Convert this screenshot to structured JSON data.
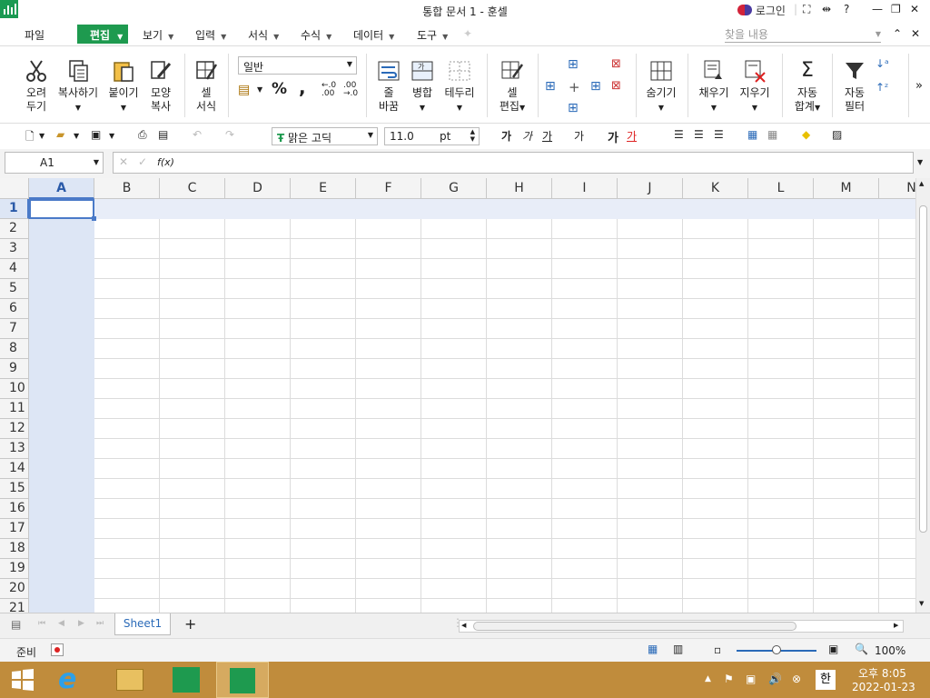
{
  "window": {
    "title": "통합 문서 1 - 훈셀",
    "login": "로그인",
    "help": "?"
  },
  "menu": {
    "items": [
      "파일",
      "편집",
      "보기",
      "입력",
      "서식",
      "수식",
      "데이터",
      "도구"
    ],
    "search_placeholder": "찾을 내용"
  },
  "ribbon": {
    "cut": [
      "오려",
      "두기"
    ],
    "copy": "복사하기",
    "paste": "붙이기",
    "format_painter": [
      "모양",
      "복사"
    ],
    "cell_format": [
      "셀",
      "서식"
    ],
    "number_format": "일반",
    "percent": "%",
    "comma": ",",
    "wrap": [
      "줄",
      "바꿈"
    ],
    "merge": "병합",
    "border": "테두리",
    "cell_edit": [
      "셀",
      "편집"
    ],
    "hide": "숨기기",
    "fill": "채우기",
    "clear": "지우기",
    "autosum": [
      "자동",
      "합계"
    ],
    "autofilter": [
      "자동",
      "필터"
    ],
    "more": "»"
  },
  "toolbar": {
    "font_name": "맑은 고딕",
    "font_size": "11.0",
    "font_unit": "pt",
    "bold_glyph": "가",
    "italic_glyph": "가",
    "underline_glyph": "가",
    "strike_glyph": "가",
    "big_glyph": "가",
    "color_glyph": "가"
  },
  "formula_bar": {
    "name_box": "A1",
    "fx": "f(x)",
    "formula": ""
  },
  "grid": {
    "columns": [
      "A",
      "B",
      "C",
      "D",
      "E",
      "F",
      "G",
      "H",
      "I",
      "J",
      "K",
      "L",
      "M",
      "N"
    ],
    "rows": [
      "1",
      "2",
      "3",
      "4",
      "5",
      "6",
      "7",
      "8",
      "9",
      "10",
      "11",
      "12",
      "13",
      "14",
      "15",
      "16",
      "17",
      "18",
      "19",
      "20",
      "21"
    ],
    "active_cell": "A1"
  },
  "sheets": {
    "tabs": [
      "Sheet1"
    ],
    "add": "+"
  },
  "status": {
    "ready": "준비",
    "zoom": "100%"
  },
  "taskbar": {
    "time": "오후 8:05",
    "date": "2022-01-23",
    "ime": "한"
  },
  "colors": {
    "brand_green": "#1e9a4f",
    "selection_header": "#dde6f5",
    "taskbar": "#c08c3c"
  }
}
